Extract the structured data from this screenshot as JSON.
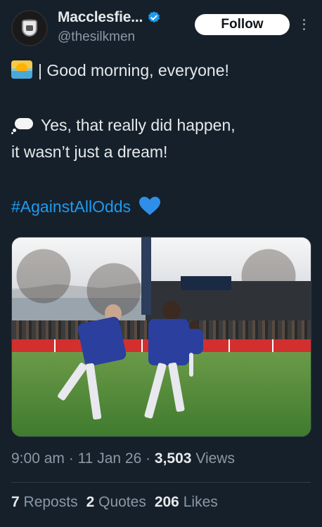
{
  "account": {
    "display_name": "Macclesfie...",
    "handle": "@thesilkmen",
    "verified": true,
    "follow_label": "Follow"
  },
  "post": {
    "line1": "| Good morning, everyone!",
    "line2": "Yes, that really did happen,",
    "line3": "it wasn’t just a dream!",
    "hashtag": "#AgainstAllOdds",
    "emoji_1": "sunrise-icon",
    "emoji_2": "thought-bubble-icon",
    "emoji_3": "blue-heart-icon"
  },
  "meta": {
    "time": "9:00 am",
    "separator": " · ",
    "date": "11 Jan 26",
    "views_count": "3,503",
    "views_label": "Views"
  },
  "stats": {
    "reposts_count": "7",
    "reposts_label": "Reposts",
    "quotes_count": "2",
    "quotes_label": "Quotes",
    "likes_count": "206",
    "likes_label": "Likes"
  },
  "colors": {
    "background": "#15202b",
    "text": "#e7e9ea",
    "secondary_text": "#8b98a5",
    "link": "#1d9bf0",
    "verified": "#1d9bf0"
  }
}
